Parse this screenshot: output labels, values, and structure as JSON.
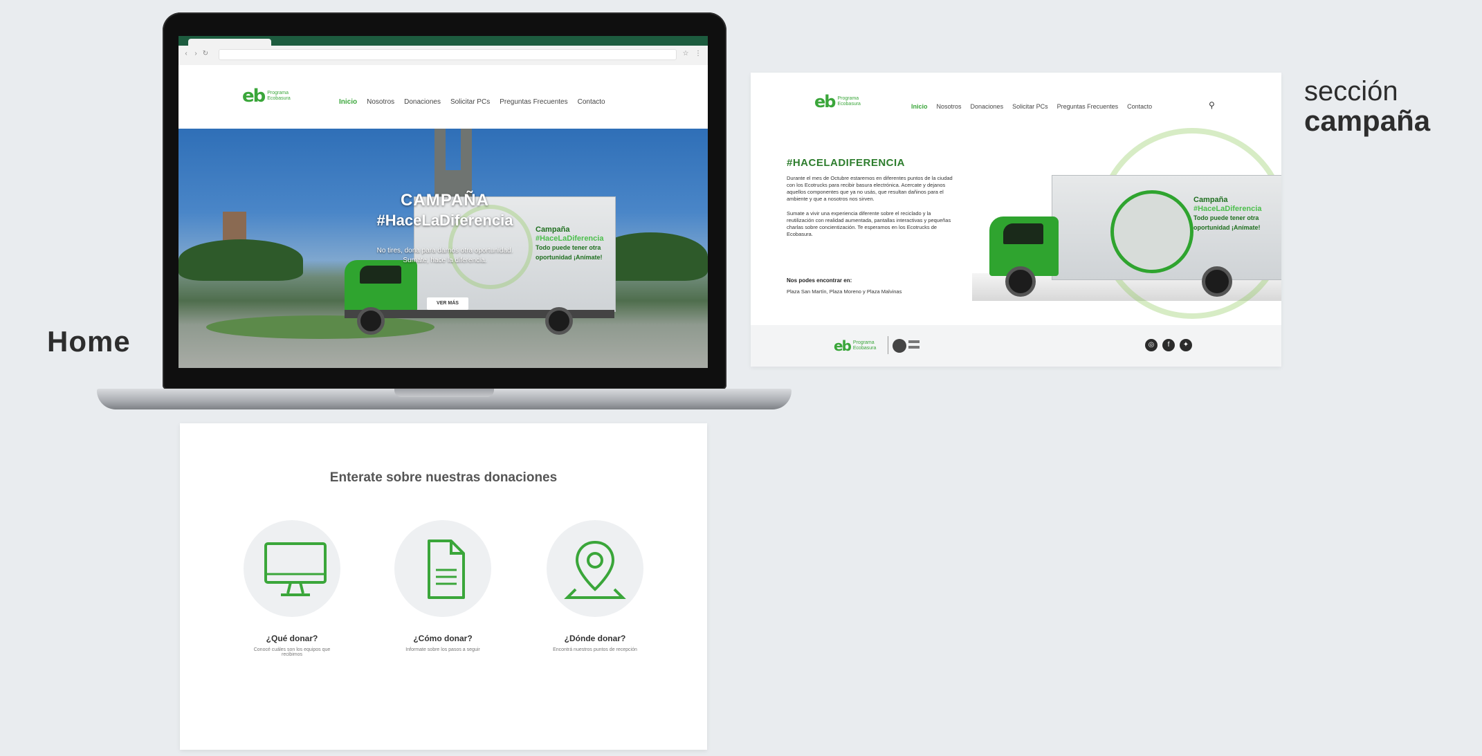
{
  "labels": {
    "home": "Home",
    "section_line1": "sección",
    "section_line2": "campaña"
  },
  "logo": {
    "mark": "eb",
    "text_line1": "Programa",
    "text_line2": "Ecobasura"
  },
  "nav": {
    "items": [
      "Inicio",
      "Nosotros",
      "Donaciones",
      "Solicitar PCs",
      "Preguntas Frecuentes",
      "Contacto"
    ]
  },
  "hero": {
    "title_line1": "CAMPAÑA",
    "title_line2": "#HaceLaDiferencia",
    "subtitle_line1": "No tires, dona para darnos otra oportunidad.",
    "subtitle_line2": "Sumate, hace la diferencia.",
    "button": "VER MÁS",
    "truck_line1": "Campaña",
    "truck_line2": "#HaceLaDiferencia",
    "truck_line3": "Todo puede tener otra",
    "truck_line4": "oportunidad ¡Anímate!"
  },
  "donations": {
    "title": "Enterate sobre nuestras donaciones",
    "cards": [
      {
        "icon": "monitor-icon",
        "title": "¿Qué donar?",
        "subtitle": "Conocé cuáles son los equipos que recibimos"
      },
      {
        "icon": "document-icon",
        "title": "¿Cómo donar?",
        "subtitle": "Informate sobre los pasos a seguir"
      },
      {
        "icon": "location-pin-icon",
        "title": "¿Dónde donar?",
        "subtitle": "Encontrá nuestros puntos de recepción"
      }
    ]
  },
  "campaign": {
    "hashtag": "#HACELADIFERENCIA",
    "para1": "Durante el mes de Octubre estaremos en diferentes puntos de la ciudad con los Ecotrucks para recibir basura electrónica. Acercate y dejanos aquellos componentes que ya no usás, que resultan dañinos para el ambiente y que a nosotros nos sirven.",
    "para2": "Sumate a vivir una experiencia diferente sobre el reciclado y la reutilización con realidad aumentada, pantallas interactivas y pequeñas charlas sobre concientización. Te esperamos en los Ecotrucks de Ecobasura.",
    "find_title": "Nos podes encontrar en:",
    "find_places": "Plaza San Martín, Plaza Moreno y Plaza Malvinas",
    "truck_line1": "Campaña",
    "truck_line2": "#HaceLaDiferencia",
    "truck_line3": "Todo puede tener otra",
    "truck_line4": "oportunidad ¡Anímate!",
    "social": [
      "instagram-icon",
      "facebook-icon",
      "twitter-icon"
    ]
  },
  "colors": {
    "green": "#3aa63a",
    "dark_green": "#1d5c3f",
    "background": "#e9ecef"
  }
}
